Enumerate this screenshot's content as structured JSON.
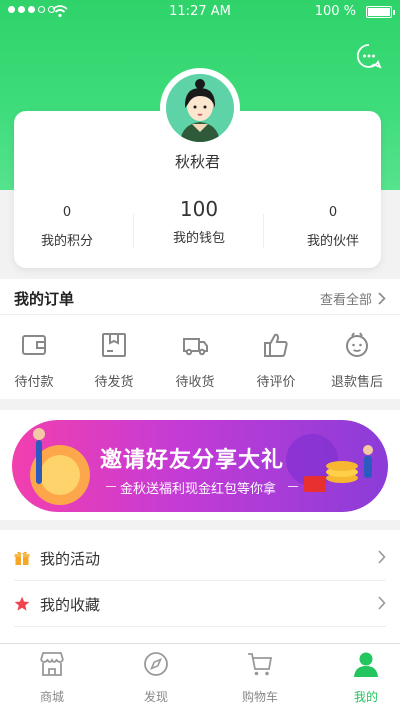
{
  "status_bar": {
    "time": "11:27 AM",
    "battery": "100 %"
  },
  "profile": {
    "username": "秋秋君"
  },
  "stats": [
    {
      "value": "0",
      "label": "我的积分"
    },
    {
      "value": "100",
      "label": "我的钱包"
    },
    {
      "value": "0",
      "label": "我的伙伴"
    }
  ],
  "orders": {
    "title": "我的订单",
    "view_all": "查看全部",
    "items": [
      {
        "label": "待付款",
        "icon": "wallet-icon"
      },
      {
        "label": "待发货",
        "icon": "box-icon"
      },
      {
        "label": "待收货",
        "icon": "truck-icon"
      },
      {
        "label": "待评价",
        "icon": "thumbs-up-icon"
      },
      {
        "label": "退款售后",
        "icon": "refund-icon"
      }
    ]
  },
  "banner": {
    "headline": "邀请好友分享大礼",
    "subline": "金秋送福利现金红包等你拿"
  },
  "menu": [
    {
      "label": "我的活动",
      "icon": "gift-icon",
      "color": "#f5a623"
    },
    {
      "label": "我的收藏",
      "icon": "star-icon",
      "color": "#f0434f"
    }
  ],
  "tabbar": {
    "active_color": "#22c55e",
    "items": [
      {
        "label": "商城",
        "icon": "shop-icon"
      },
      {
        "label": "发现",
        "icon": "compass-icon"
      },
      {
        "label": "购物车",
        "icon": "cart-icon"
      },
      {
        "label": "我的",
        "icon": "user-icon"
      }
    ]
  },
  "colors": {
    "brand_green": "#2fd36a",
    "banner_pink": "#f23fae",
    "banner_purple": "#8b3cd8"
  }
}
